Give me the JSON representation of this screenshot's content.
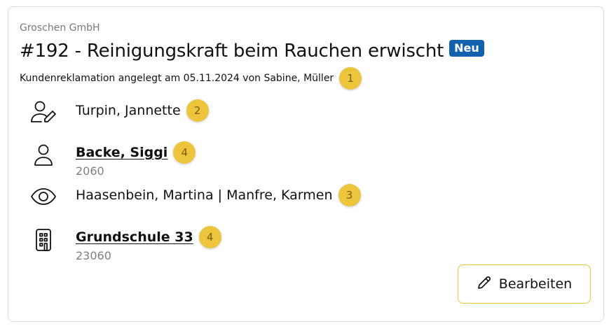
{
  "header": {
    "company": "Groschen GmbH",
    "title": "#192 - Reinigungskraft beim Rauchen erwischt",
    "badge": "Neu",
    "subtitle": "Kundenreklamation angelegt am 05.11.2024 von Sabine, Müller",
    "subtitle_marker": "1"
  },
  "rows": [
    {
      "icon": "user-edit-icon",
      "text": "Turpin, Jannette",
      "marker": "2"
    },
    {
      "icon": "user-icon",
      "text": "Backe, Siggi",
      "code": "2060",
      "marker": "4",
      "link": true
    },
    {
      "icon": "eye-icon",
      "text": "Haasenbein, Martina | Manfre, Karmen",
      "marker": "3"
    },
    {
      "icon": "building-icon",
      "text": "Grundschule 33",
      "code": "23060",
      "marker": "4",
      "link": true
    }
  ],
  "actions": {
    "edit_label": "Bearbeiten",
    "edit_icon": "pencil-icon"
  },
  "colors": {
    "badge": "#1161ad",
    "marker": "#ecc53c",
    "button_border": "#e8c437"
  }
}
